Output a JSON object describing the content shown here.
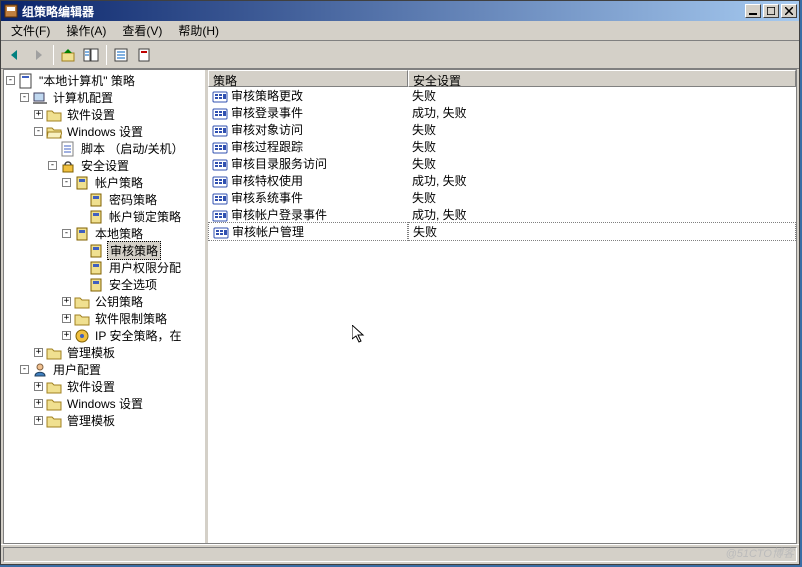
{
  "title": "组策略编辑器",
  "menu": {
    "file": "文件(F)",
    "action": "操作(A)",
    "view": "查看(V)",
    "help": "帮助(H)"
  },
  "tree": {
    "root": "\"本地计算机\" 策略",
    "computer_config": "计算机配置",
    "cc_software": "软件设置",
    "cc_windows": "Windows 设置",
    "cc_script": "脚本 （启动/关机）",
    "cc_security": "安全设置",
    "cc_account_policy": "帐户策略",
    "cc_password": "密码策略",
    "cc_lockout": "帐户锁定策略",
    "cc_local_policy": "本地策略",
    "cc_audit": "审核策略",
    "cc_rights": "用户权限分配",
    "cc_options": "安全选项",
    "cc_pubkey": "公钥策略",
    "cc_swrestrict": "软件限制策略",
    "cc_ipsec": "IP 安全策略，在",
    "cc_admin_tpl": "管理模板",
    "user_config": "用户配置",
    "uc_software": "软件设置",
    "uc_windows": "Windows 设置",
    "uc_admin_tpl": "管理模板"
  },
  "columns": {
    "policy": "策略",
    "setting": "安全设置"
  },
  "rows": [
    {
      "name": "审核策略更改",
      "value": "失败"
    },
    {
      "name": "审核登录事件",
      "value": "成功, 失败"
    },
    {
      "name": "审核对象访问",
      "value": "失败"
    },
    {
      "name": "审核过程跟踪",
      "value": "失败"
    },
    {
      "name": "审核目录服务访问",
      "value": "失败"
    },
    {
      "name": "审核特权使用",
      "value": "成功, 失败"
    },
    {
      "name": "审核系统事件",
      "value": "失败"
    },
    {
      "name": "审核帐户登录事件",
      "value": "成功, 失败"
    },
    {
      "name": "审核帐户管理",
      "value": "失败"
    }
  ],
  "watermark": "@51CTO博客"
}
